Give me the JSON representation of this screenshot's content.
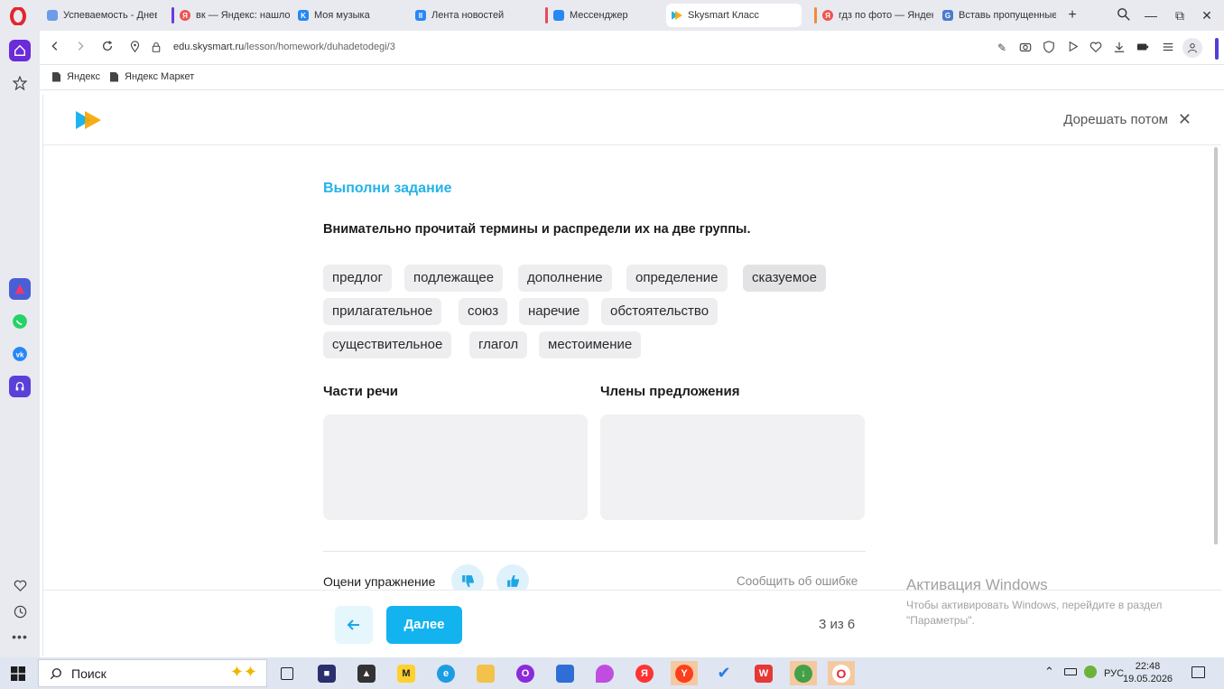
{
  "tabs": [
    {
      "label": "Успеваемость - Дневн",
      "fav_color": "#6c9be8"
    },
    {
      "label": "вк — Яндекс: нашлос",
      "fav_color": "#ef5350"
    },
    {
      "label": "Моя музыка",
      "fav_color": "#2787f5"
    },
    {
      "label": "Лента новостей",
      "fav_color": "#2787f5"
    },
    {
      "label": "Мессенджер",
      "fav_color": "#2787f5"
    },
    {
      "label": "Skysmart Класс",
      "fav_color": "#1eb4ef"
    },
    {
      "label": "гдз по фото — Яндекс",
      "fav_color": "#ef5350"
    },
    {
      "label": "Вставь пропущенные",
      "fav_color": "#4a7bd0"
    }
  ],
  "address": {
    "domain": "edu.skysmart.ru",
    "path": "/lesson/homework/duhadetodegi/3"
  },
  "bookmarks": [
    "Яндекс",
    "Яндекс Маркет"
  ],
  "page": {
    "finish_later": "Дорешать потом",
    "task_title": "Выполни задание",
    "task_text": "Внимательно прочитай термины и распредели их на две группы.",
    "chips": [
      "предлог",
      "подлежащее",
      "дополнение",
      "определение",
      "сказуемое",
      "прилагательное",
      "союз",
      "наречие",
      "обстоятельство",
      "существительное",
      "глагол",
      "местоимение"
    ],
    "groups": [
      "Части речи",
      "Члены предложения"
    ],
    "rate_label": "Оцени упражнение",
    "report": "Сообщить об ошибке",
    "next_label": "Далее",
    "progress": "3 из 6"
  },
  "activation": {
    "title": "Активация Windows",
    "text": "Чтобы активировать Windows, перейдите в раздел \"Параметры\"."
  },
  "taskbar": {
    "search_label": "Поиск",
    "lang": "РУС",
    "time": "22:48",
    "date": "19.05.2026"
  },
  "colors": {
    "accent": "#13b3ef",
    "title_blue": "#23b3e8",
    "chip_bg": "#eeeef0",
    "drop_zone_bg": "#f1f1f3"
  }
}
